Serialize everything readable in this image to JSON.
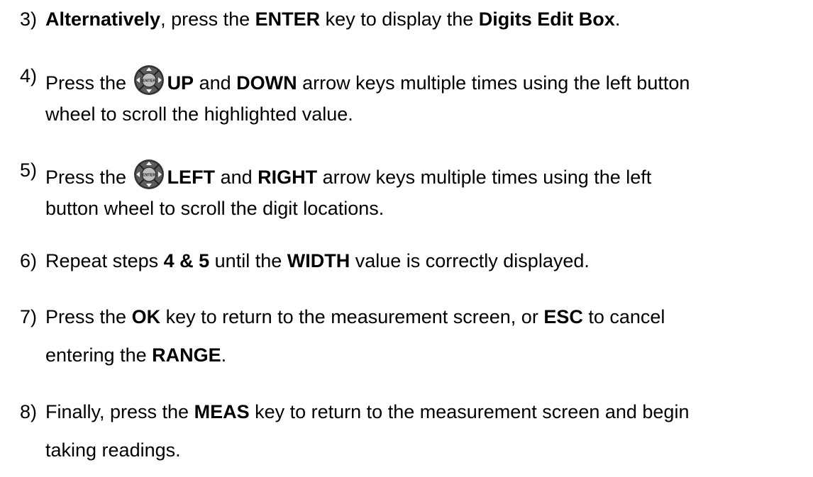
{
  "steps": [
    {
      "num": "3)",
      "lines": [
        [
          {
            "t": "Alternatively",
            "b": true
          },
          {
            "t": ", press the ",
            "b": false
          },
          {
            "t": "ENTER",
            "b": true
          },
          {
            "t": " key to display the ",
            "b": false
          },
          {
            "t": "Digits Edit Box",
            "b": true
          },
          {
            "t": ".",
            "b": false
          }
        ]
      ]
    },
    {
      "num": "4)",
      "lines": [
        [
          {
            "t": "Press the ",
            "b": false
          },
          {
            "icon": "button-wheel-icon"
          },
          {
            "t": "UP",
            "b": true
          },
          {
            "t": " and ",
            "b": false
          },
          {
            "t": "DOWN",
            "b": true
          },
          {
            "t": " arrow keys multiple times using the left button",
            "b": false
          }
        ],
        [
          {
            "t": "wheel to scroll the highlighted value.",
            "b": false
          }
        ]
      ]
    },
    {
      "num": "5)",
      "lines": [
        [
          {
            "t": "Press the ",
            "b": false
          },
          {
            "icon": "button-wheel-icon"
          },
          {
            "t": "LEFT",
            "b": true
          },
          {
            "t": " and ",
            "b": false
          },
          {
            "t": "RIGHT",
            "b": true
          },
          {
            "t": " arrow keys multiple times using the left",
            "b": false
          }
        ],
        [
          {
            "t": "button wheel to scroll the digit locations.",
            "b": false
          }
        ]
      ]
    },
    {
      "num": "6)",
      "lines": [
        [
          {
            "t": "Repeat steps ",
            "b": false
          },
          {
            "t": "4 & 5",
            "b": true
          },
          {
            "t": " until the ",
            "b": false
          },
          {
            "t": "WIDTH",
            "b": true
          },
          {
            "t": " value is correctly displayed.",
            "b": false
          }
        ]
      ]
    },
    {
      "num": "7)",
      "lines": [
        [
          {
            "t": "Press the ",
            "b": false
          },
          {
            "t": "OK",
            "b": true
          },
          {
            "t": " key to return to the measurement screen, or ",
            "b": false
          },
          {
            "t": "ESC",
            "b": true
          },
          {
            "t": " to cancel",
            "b": false
          }
        ],
        [
          {
            "t": "entering the ",
            "b": false
          },
          {
            "t": "RANGE",
            "b": true
          },
          {
            "t": ".",
            "b": false
          }
        ]
      ]
    },
    {
      "num": "8)",
      "lines": [
        [
          {
            "t": "Finally, press the ",
            "b": false
          },
          {
            "t": "MEAS",
            "b": true
          },
          {
            "t": " key to return to the measurement screen and begin",
            "b": false
          }
        ],
        [
          {
            "t": "taking readings.",
            "b": false
          }
        ]
      ]
    }
  ],
  "icon_label": "ENTER"
}
